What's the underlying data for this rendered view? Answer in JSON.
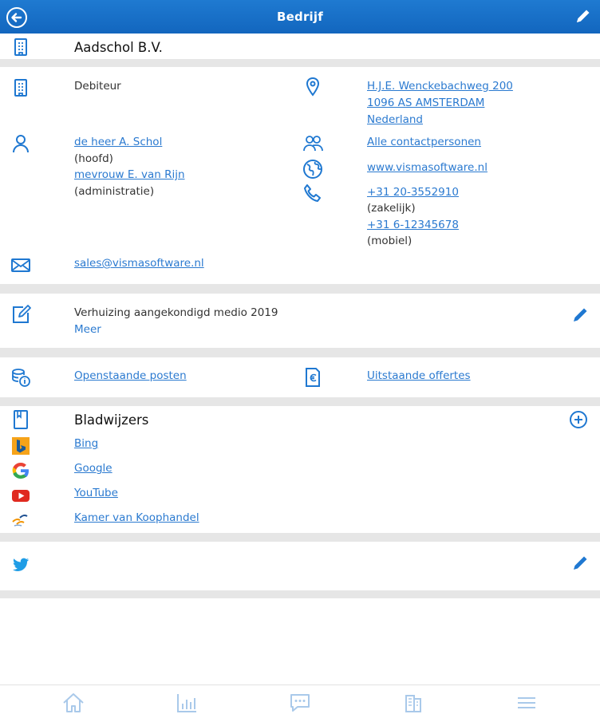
{
  "header": {
    "title": "Bedrijf"
  },
  "company": {
    "name": "Aadschol B.V."
  },
  "info": {
    "type": "Debiteur",
    "address": [
      "H.J.E. Wenckebachweg 200",
      "1096 AS AMSTERDAM",
      "Nederland"
    ],
    "contacts": [
      {
        "name": "de heer A. Schol",
        "role": "(hoofd)"
      },
      {
        "name": "mevrouw E. van Rijn",
        "role": "(administratie)"
      }
    ],
    "all_contacts": "Alle contactpersonen",
    "website": "www.vismasoftware.nl",
    "phones": [
      {
        "number": "+31 20-3552910",
        "type": "(zakelijk)"
      },
      {
        "number": "+31 6-12345678",
        "type": "(mobiel)"
      }
    ],
    "email": "sales@vismasoftware.nl"
  },
  "note": {
    "text": "Verhuizing aangekondigd medio 2019",
    "more": "Meer"
  },
  "finance": {
    "open_items": "Openstaande posten",
    "offers": "Uitstaande offertes"
  },
  "bookmarks": {
    "title": "Bladwijzers",
    "items": [
      {
        "label": "Bing",
        "icon": "bing-icon"
      },
      {
        "label": "Google",
        "icon": "google-icon"
      },
      {
        "label": "YouTube",
        "icon": "youtube-icon"
      },
      {
        "label": "Kamer van Koophandel",
        "icon": "kvk-icon"
      }
    ]
  },
  "colors": {
    "accent": "#1f78d1",
    "link": "#2b7ad0",
    "separator": "#e6e6e6"
  }
}
